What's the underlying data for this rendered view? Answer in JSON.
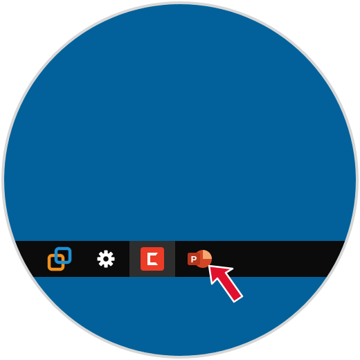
{
  "colors": {
    "desktop_background": "#02619a",
    "taskbar": "#0b0b0b",
    "taskbar_active_item": "#2e2e2e",
    "vmware_orange": "#f0921e",
    "vmware_blue": "#1d8fd6",
    "settings_gear": "#ffffff",
    "camtasia_red": "#ec3b26",
    "powerpoint_orange": "#d24726",
    "pointer_arrow": "#e1102f",
    "circle_border": "#d6d6d6"
  },
  "taskbar": {
    "items": [
      {
        "id": "partial",
        "icon": "partial-app-icon",
        "active": false
      },
      {
        "id": "vmware",
        "icon": "vmware-icon",
        "active": false
      },
      {
        "id": "settings",
        "icon": "gear-icon",
        "active": false
      },
      {
        "id": "camtasia",
        "icon": "camtasia-icon",
        "active": true
      },
      {
        "id": "powerpoint",
        "icon": "powerpoint-icon",
        "active": false
      }
    ]
  },
  "powerpoint_icon": {
    "letter": "P"
  },
  "annotation": {
    "icon": "red-pointer-arrow",
    "points_to": "powerpoint"
  }
}
